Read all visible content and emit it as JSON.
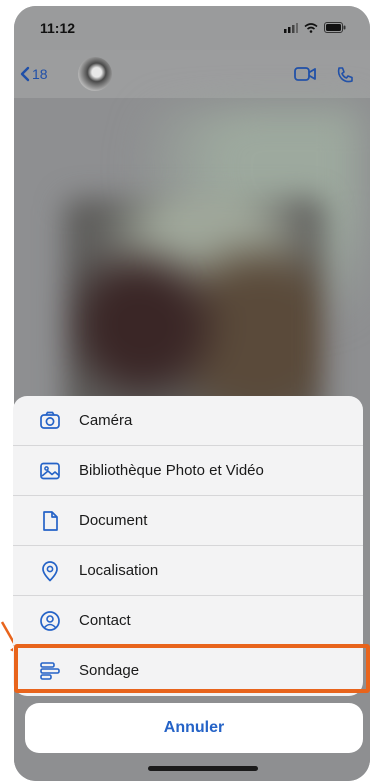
{
  "status": {
    "time": "11:12"
  },
  "header": {
    "back_count": "18"
  },
  "menu": {
    "items": [
      {
        "label": "Caméra",
        "icon": "camera-icon"
      },
      {
        "label": "Bibliothèque Photo et Vidéo",
        "icon": "photo-library-icon"
      },
      {
        "label": "Document",
        "icon": "document-icon"
      },
      {
        "label": "Localisation",
        "icon": "location-icon"
      },
      {
        "label": "Contact",
        "icon": "contact-icon"
      },
      {
        "label": "Sondage",
        "icon": "poll-icon"
      }
    ],
    "cancel_label": "Annuler"
  },
  "colors": {
    "accent": "#2563c7",
    "highlight": "#e8641c"
  }
}
